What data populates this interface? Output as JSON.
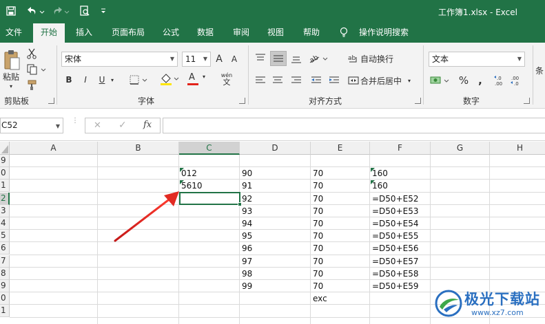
{
  "title_bar": {
    "title": "工作簿1.xlsx  -  Excel",
    "accent_color": "#217346"
  },
  "ribbon_tabs": [
    {
      "label": "文件",
      "active": false
    },
    {
      "label": "开始",
      "active": true
    },
    {
      "label": "插入",
      "active": false
    },
    {
      "label": "页面布局",
      "active": false
    },
    {
      "label": "公式",
      "active": false
    },
    {
      "label": "数据",
      "active": false
    },
    {
      "label": "审阅",
      "active": false
    },
    {
      "label": "视图",
      "active": false
    },
    {
      "label": "帮助",
      "active": false
    },
    {
      "label": "操作说明搜索",
      "active": false
    }
  ],
  "clipboard": {
    "paste_label": "粘贴",
    "group_label": "剪贴板"
  },
  "font": {
    "font_name": "宋体",
    "font_size": "11",
    "grow_label": "A",
    "shrink_label": "A",
    "bold": "B",
    "italic": "I",
    "underline": "U",
    "font_color_letter": "A",
    "phonetic_label": "wén",
    "group_label": "字体",
    "fill_color": "#ffe600",
    "font_color": "#e2231a"
  },
  "alignment": {
    "wrap_label": "自动换行",
    "merge_label": "合并后居中",
    "group_label": "对齐方式"
  },
  "number": {
    "format": "文本",
    "percent": "%",
    "comma": ",",
    "group_label": "数字",
    "overflow_label": "条"
  },
  "formula_bar": {
    "name_box": "C52",
    "cancel": "✕",
    "enter": "✓",
    "fx": "fx",
    "value": ""
  },
  "sheet": {
    "columns": [
      "A",
      "B",
      "C",
      "D",
      "E",
      "F",
      "G",
      "H"
    ],
    "selected_column": "C",
    "row_numbers": [
      "9",
      "0",
      "1",
      "2",
      "3",
      "4",
      "5",
      "6",
      "7",
      "8",
      "9",
      "0",
      "1"
    ],
    "selected_row_index": 3,
    "rows": [
      {
        "C": "",
        "D": "",
        "E": "",
        "F": ""
      },
      {
        "C": "012",
        "D": "90",
        "E": "70",
        "F": "160"
      },
      {
        "C": "5610",
        "D": "91",
        "E": "70",
        "F": "160"
      },
      {
        "C": "",
        "D": "92",
        "E": "70",
        "F": "=D50+E52"
      },
      {
        "C": "",
        "D": "93",
        "E": "70",
        "F": "=D50+E53"
      },
      {
        "C": "",
        "D": "94",
        "E": "70",
        "F": "=D50+E54"
      },
      {
        "C": "",
        "D": "95",
        "E": "70",
        "F": "=D50+E55"
      },
      {
        "C": "",
        "D": "96",
        "E": "70",
        "F": "=D50+E56"
      },
      {
        "C": "",
        "D": "97",
        "E": "70",
        "F": "=D50+E57"
      },
      {
        "C": "",
        "D": "98",
        "E": "70",
        "F": "=D50+E58"
      },
      {
        "C": "",
        "D": "99",
        "E": "70",
        "F": "=D50+E59"
      },
      {
        "C": "",
        "D": "",
        "E": "exc",
        "F": ""
      },
      {
        "C": "",
        "D": "",
        "E": "",
        "F": ""
      }
    ]
  },
  "watermark": {
    "line1": "极光下载站",
    "line2": "www.xz7.com"
  }
}
